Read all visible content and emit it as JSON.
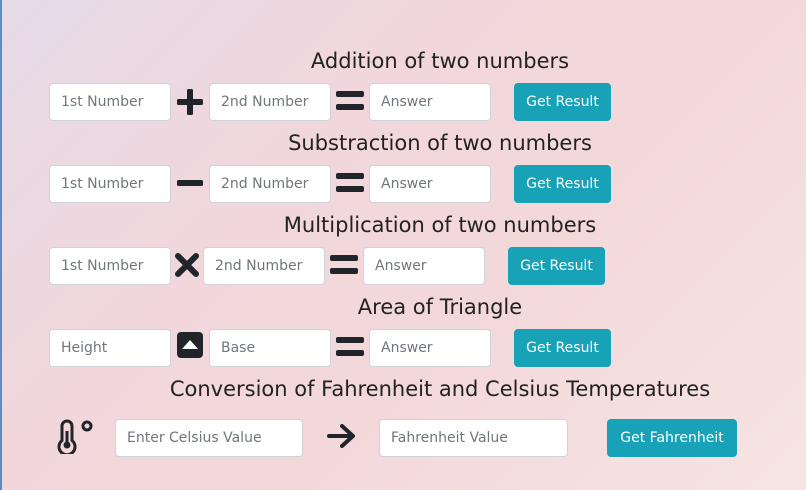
{
  "addition": {
    "title": "Addition of two numbers",
    "first_placeholder": "1st Number",
    "second_placeholder": "2nd Number",
    "answer_placeholder": "Answer",
    "button_label": "Get Result"
  },
  "subtraction": {
    "title": "Substraction of two numbers",
    "first_placeholder": "1st Number",
    "second_placeholder": "2nd Number",
    "answer_placeholder": "Answer",
    "button_label": "Get Result"
  },
  "multiplication": {
    "title": "Multiplication of two numbers",
    "first_placeholder": "1st Number",
    "second_placeholder": "2nd Number",
    "answer_placeholder": "Answer",
    "button_label": "Get Result"
  },
  "triangle": {
    "title": "Area of Triangle",
    "height_placeholder": "Height",
    "base_placeholder": "Base",
    "answer_placeholder": "Answer",
    "button_label": "Get Result"
  },
  "temperature": {
    "title": "Conversion of Fahrenheit and Celsius Temperatures",
    "celsius_placeholder": "Enter Celsius Value",
    "fahrenheit_placeholder": "Fahrenheit Value",
    "button_label": "Get Fahrenheit"
  },
  "icons": {
    "plus": "plus-icon",
    "minus": "minus-icon",
    "times": "times-icon",
    "equals": "equals-icon",
    "triangle": "caret-square-up-icon",
    "thermometer": "thermometer-degree-icon",
    "arrow": "arrow-right-icon"
  },
  "colors": {
    "accent": "#17a2b8",
    "heading_text": "#222222",
    "icon": "#212529"
  }
}
